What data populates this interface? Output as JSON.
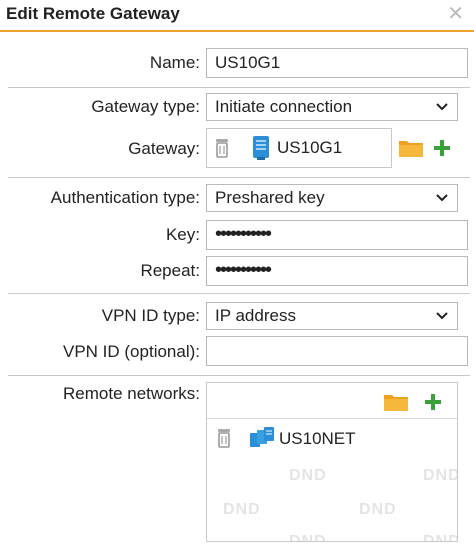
{
  "dialog": {
    "title": "Edit Remote Gateway",
    "close_icon": "close-icon"
  },
  "name": {
    "label": "Name:",
    "value": "US10G1"
  },
  "gateway_type": {
    "label": "Gateway type:",
    "value": "Initiate connection"
  },
  "gateway": {
    "label": "Gateway:",
    "item": "US10G1",
    "icons": [
      "trash-icon",
      "gateway-icon",
      "folder-icon",
      "add-icon"
    ]
  },
  "authentication_type": {
    "label": "Authentication type:",
    "value": "Preshared key"
  },
  "key": {
    "label": "Key:",
    "value": "•••••••••••"
  },
  "repeat": {
    "label": "Repeat:",
    "value": "•••••••••••"
  },
  "vpn_id_type": {
    "label": "VPN ID type:",
    "value": "IP address"
  },
  "vpn_id": {
    "label": "VPN ID (optional):",
    "value": ""
  },
  "remote_networks": {
    "label": "Remote networks:",
    "items": [
      "US10NET"
    ],
    "watermark": "DND"
  },
  "colors": {
    "accent": "#f0a030",
    "add_green": "#3aa03a",
    "folder_orange": "#f0a020",
    "gateway_blue": "#2a8fd6"
  }
}
